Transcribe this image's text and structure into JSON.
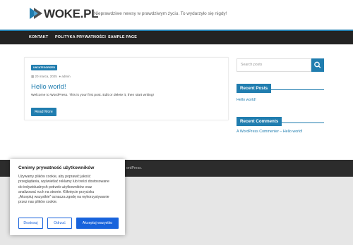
{
  "site": {
    "logo_text": "WOKE.PL",
    "tagline": "Nieprawdziwe newsy w prawdziwym życiu. To wydarzyło się nigdy!"
  },
  "nav": {
    "items": [
      "KONTAKT",
      "POLITYKA PRYWATNOŚCI",
      "SAMPLE PAGE"
    ]
  },
  "post": {
    "category": "UNCATEGORIZED",
    "date": "20 marca, 2025",
    "author": "admin",
    "title": "Hello world!",
    "excerpt": "Welcome to WordPress. This is your first post. Edit or delete it, then start writing!",
    "read_more": "Read More"
  },
  "sidebar": {
    "search_placeholder": "Search posts",
    "recent_posts_title": "Recent Posts",
    "recent_posts": [
      "Hello world!"
    ],
    "recent_comments_title": "Recent Comments",
    "recent_comments": [
      "A WordPress Commenter – Hello world!"
    ]
  },
  "footer": {
    "text": "ordPress."
  },
  "cookie": {
    "title": "Cenimy prywatność użytkowników",
    "lines": [
      "Używamy plików cookie, aby poprawić jakość",
      "przeglądania, wyświetlać reklamy lub treści dostosowane",
      "do indywidualnych potrzeb użytkowników oraz",
      "analizować ruch na stronie. Kliknięcie przycisku",
      "„Akceptuj wszystkie” oznacza zgodę na wykorzystywanie",
      "przez nas plików cookie."
    ],
    "btn_customize": "Dostosuj",
    "btn_reject": "Odrzuć",
    "btn_accept": "Akceptuj wszystko"
  },
  "colors": {
    "accent": "#207daf",
    "cookie_accent": "#1863dc",
    "nav_bg": "#232323",
    "footer_bg": "#2c2c2c"
  }
}
